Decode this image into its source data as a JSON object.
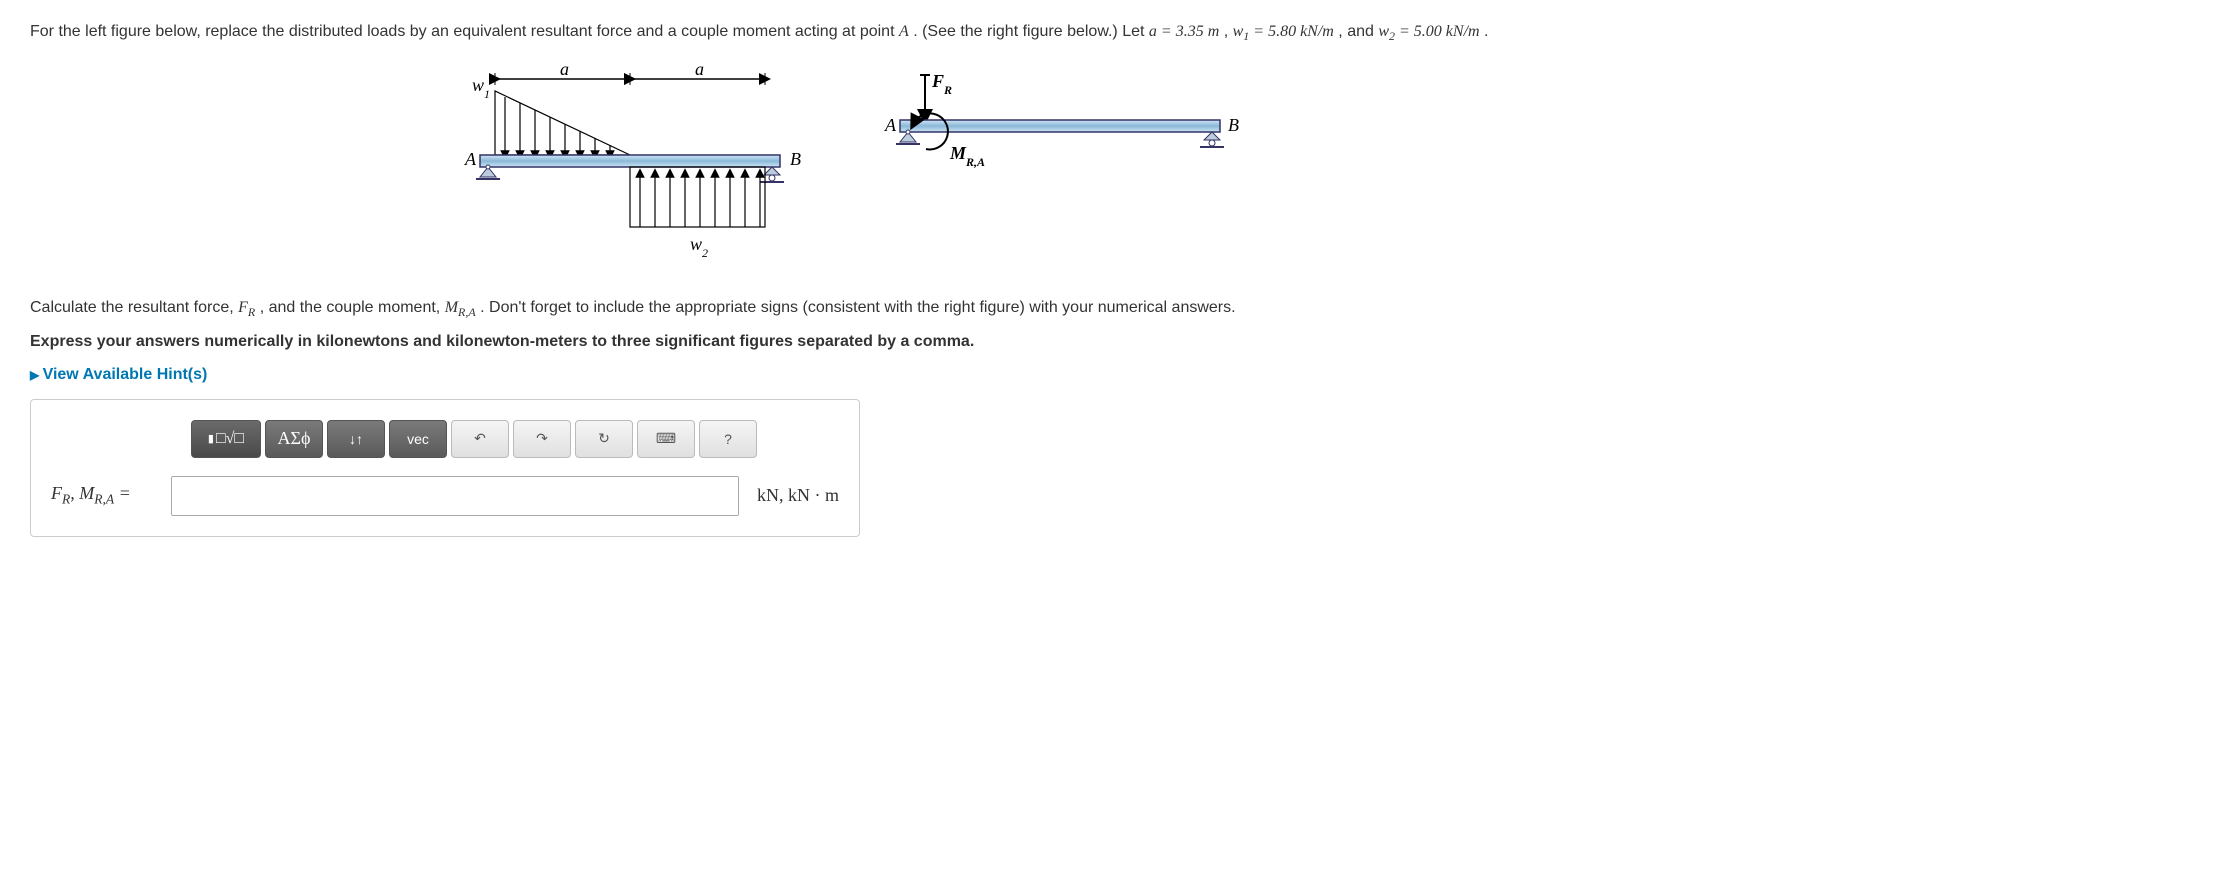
{
  "problem": {
    "intro_prefix": "For the left figure below, replace the distributed loads by an equivalent resultant force and a couple moment acting at point ",
    "point_label": "A",
    "intro_mid": ". (See the right figure below.) Let ",
    "a_expr": "a = 3.35 m",
    "sep1": " , ",
    "w1_expr_pre": "w",
    "w1_sub": "1",
    "w1_expr_post": " = 5.80 kN/m",
    "sep2": " , and ",
    "w2_expr_pre": "w",
    "w2_sub": "2",
    "w2_expr_post": " = 5.00 kN/m",
    "period": " ."
  },
  "instruction": {
    "prefix": "Calculate the resultant force, ",
    "fr_sym_pre": "F",
    "fr_sym_sub": "R",
    "mid1": ", and the couple moment, ",
    "mra_sym_pre": "M",
    "mra_sym_sub": "R,A",
    "suffix": ". Don't forget to include the appropriate signs (consistent with the right figure) with your numerical answers."
  },
  "bold_instruction": "Express your answers numerically in kilonewtons and kilonewton-meters to three significant figures separated by a comma.",
  "hints_link": "View Available Hint(s)",
  "toolbar": {
    "template": "□√□",
    "greek": "ΑΣϕ",
    "subscript": "↓↑",
    "vec": "vec",
    "undo": "↶",
    "redo": "↷",
    "reset": "↻",
    "keyboard": "⌨",
    "help": "?"
  },
  "answer": {
    "label_pre1": "F",
    "label_sub1": "R",
    "label_sep": ", ",
    "label_pre2": "M",
    "label_sub2": "R,A",
    "eq": " = ",
    "units": "kN,  kN · m"
  },
  "figure": {
    "w1": "w",
    "w1_sub": "1",
    "w2": "w",
    "w2_sub": "2",
    "a": "a",
    "A": "A",
    "B": "B",
    "FR_pre": "F",
    "FR_sub": "R",
    "MRA_pre": "M",
    "MRA_sub": "R,A"
  }
}
